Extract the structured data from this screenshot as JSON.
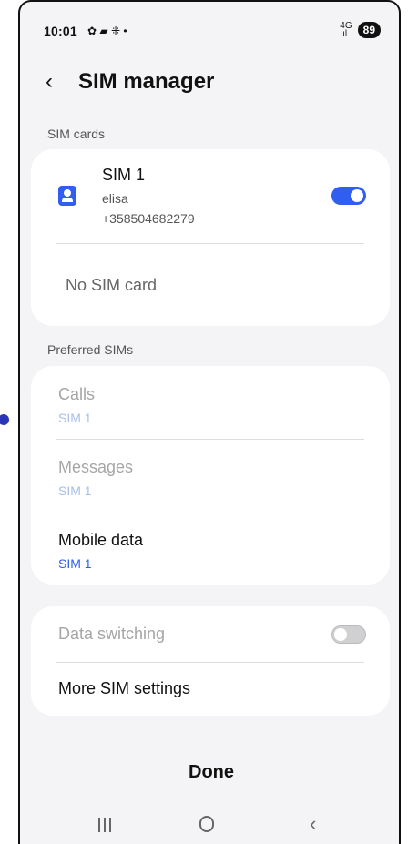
{
  "status_bar": {
    "time": "10:01",
    "notification_icons": "✿ ▰ ⁜ •",
    "network": "4G",
    "battery": "89"
  },
  "header": {
    "back_icon": "‹",
    "title": "SIM manager"
  },
  "sim_cards": {
    "section_label": "SIM cards",
    "sim1": {
      "name": "SIM 1",
      "operator": "elisa",
      "number": "+358504682279",
      "enabled": true
    },
    "sim2": {
      "label": "No SIM card"
    }
  },
  "preferred": {
    "section_label": "Preferred SIMs",
    "calls": {
      "title": "Calls",
      "value": "SIM 1"
    },
    "messages": {
      "title": "Messages",
      "value": "SIM 1"
    },
    "mobile_data": {
      "title": "Mobile data",
      "value": "SIM 1"
    }
  },
  "more": {
    "data_switching": {
      "label": "Data switching",
      "enabled": false
    },
    "more_settings": {
      "label": "More SIM settings"
    }
  },
  "footer": {
    "done_label": "Done"
  },
  "colors": {
    "accent": "#2f5ef0",
    "background": "#f4f4f6",
    "card": "#ffffff"
  },
  "nav": {
    "back_glyph": "‹"
  }
}
